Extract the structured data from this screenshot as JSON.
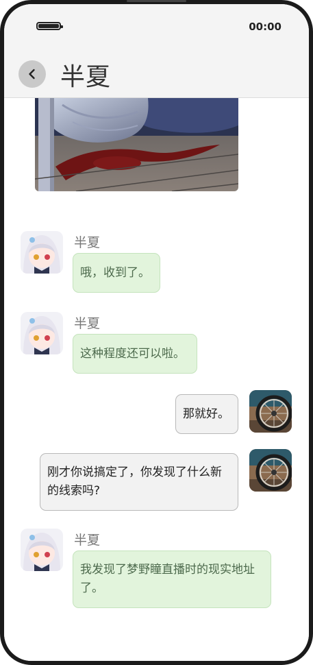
{
  "status_bar": {
    "time": "00:00",
    "battery_icon": "battery-icon"
  },
  "header": {
    "title": "半夏",
    "back_icon": "chevron-left-icon"
  },
  "colors": {
    "incoming_bubble": "#e2f4dc",
    "outgoing_bubble": "#f2f2f2",
    "header_bg": "#f4f4f4",
    "back_button": "#c9c9c9"
  },
  "messages": [
    {
      "sender": "半夏",
      "direction": "incoming",
      "text": "哦，收到了。"
    },
    {
      "sender": "半夏",
      "direction": "incoming",
      "text": "这种程度还可以啦。"
    },
    {
      "sender": "",
      "direction": "outgoing",
      "text": "那就好。"
    },
    {
      "sender": "",
      "direction": "outgoing",
      "text": "刚才你说搞定了，你发现了什么新的线索吗?"
    },
    {
      "sender": "半夏",
      "direction": "incoming",
      "text": "我发现了梦野瞳直播时的现实地址了。"
    }
  ]
}
